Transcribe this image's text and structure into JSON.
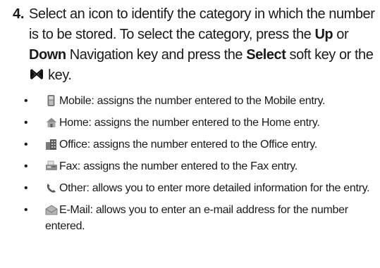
{
  "step": {
    "number": "4.",
    "text_1": "Select an icon to identify the category in which the number is to be stored. To select the category, press the ",
    "key_up": "Up",
    "text_2": " or ",
    "key_down": "Down",
    "text_3": " Navigation key and press the ",
    "key_select": "Select",
    "text_4": " soft key or the ",
    "key_icon": "center-select-key-icon",
    "text_5": " key."
  },
  "bullets": [
    {
      "icon": "mobile-phone-icon",
      "text": "Mobile: assigns the number entered to the Mobile entry."
    },
    {
      "icon": "home-icon",
      "text": "Home: assigns the number entered to the Home entry."
    },
    {
      "icon": "office-building-icon",
      "text": "Office: assigns the number entered to the Office entry."
    },
    {
      "icon": "fax-machine-icon",
      "text": "Fax: assigns the number entered to the Fax entry."
    },
    {
      "icon": "handset-icon",
      "text": "Other: allows you to enter more detailed information for the entry."
    },
    {
      "icon": "email-envelope-icon",
      "text": "E-Mail: allows you to enter an e-mail address for the number entered."
    }
  ],
  "bullet_marker": "•"
}
